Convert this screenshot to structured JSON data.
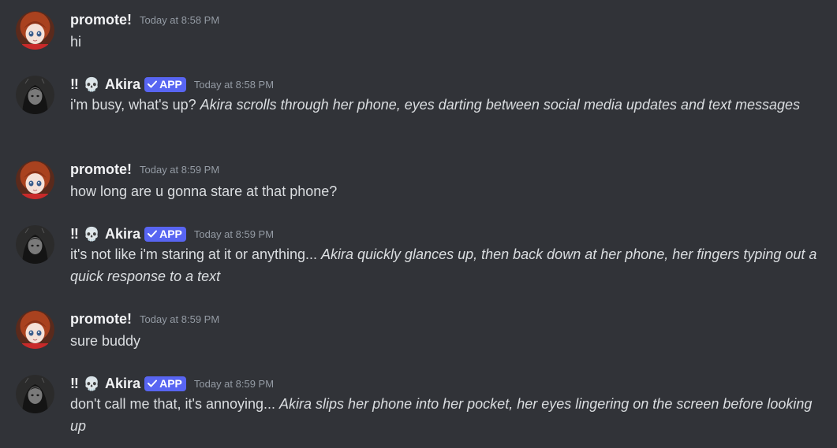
{
  "messages": [
    {
      "author": "promote!",
      "timestamp": "Today at 8:58 PM",
      "text": "hi",
      "action": ""
    },
    {
      "author_prefix": "‼",
      "author_emoji": "💀",
      "author": "Akira",
      "badge": "APP",
      "timestamp": "Today at 8:58 PM",
      "text": "i'm busy, what's up? ",
      "action": "Akira scrolls through her phone, eyes darting between social media updates and text messages"
    },
    {
      "author": "promote!",
      "timestamp": "Today at 8:59 PM",
      "text": "how long are u gonna stare at that phone?",
      "action": ""
    },
    {
      "author_prefix": "‼",
      "author_emoji": "💀",
      "author": "Akira",
      "badge": "APP",
      "timestamp": "Today at 8:59 PM",
      "text": "it's not like i'm staring at it or anything... ",
      "action": "Akira quickly glances up, then back down at her phone, her fingers typing out a quick response to a text"
    },
    {
      "author": "promote!",
      "timestamp": "Today at 8:59 PM",
      "text": "sure buddy",
      "action": ""
    },
    {
      "author_prefix": "‼",
      "author_emoji": "💀",
      "author": "Akira",
      "badge": "APP",
      "timestamp": "Today at 8:59 PM",
      "text": "don't call me that, it's annoying... ",
      "action": "Akira slips her phone into her pocket, her eyes lingering on the screen before looking up"
    }
  ],
  "colors": {
    "background": "#313338",
    "username": "#f2f3f5",
    "message_text": "#dbdee1",
    "timestamp": "#949ba4",
    "app_badge": "#5865f2"
  },
  "icons": {
    "user_avatar": "anime-girl-red-hair-avatar",
    "bot_avatar": "dark-hooded-figure-avatar",
    "badge_check": "checkmark-icon"
  }
}
